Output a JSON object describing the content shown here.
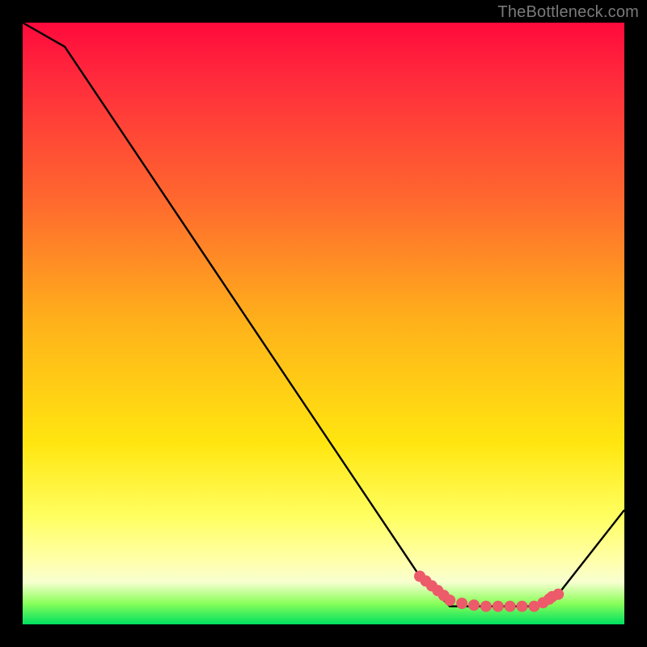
{
  "attribution": "TheBottleneck.com",
  "colors": {
    "marker": "#ed5a6a",
    "line": "#000000"
  },
  "chart_data": {
    "type": "line",
    "title": "",
    "xlabel": "",
    "ylabel": "",
    "xlim": [
      0,
      100
    ],
    "ylim": [
      0,
      100
    ],
    "series": [
      {
        "name": "curve",
        "x": [
          0,
          7,
          66,
          71,
          85,
          89,
          100
        ],
        "y": [
          100,
          96,
          8,
          3,
          3,
          5,
          19
        ]
      }
    ],
    "markers": {
      "name": "highlight-band",
      "x": [
        66,
        67,
        68,
        69,
        70,
        71,
        73,
        75,
        77,
        79,
        81,
        83,
        85,
        86.5,
        87.5,
        88,
        89
      ],
      "y": [
        8,
        7.2,
        6.4,
        5.6,
        4.8,
        4,
        3.5,
        3.2,
        3.0,
        3.0,
        3.0,
        3.0,
        3.0,
        3.6,
        4.2,
        4.6,
        5.0
      ]
    }
  }
}
